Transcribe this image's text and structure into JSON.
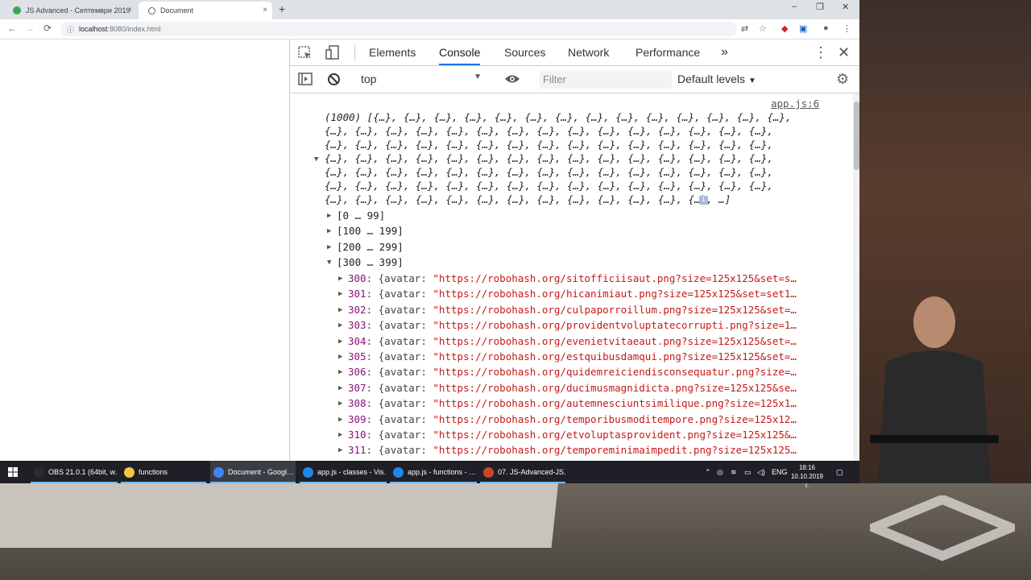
{
  "browser": {
    "tabs": [
      {
        "title": "JS Advanced - Септември 2019",
        "close": "×"
      },
      {
        "title": "Document",
        "close": "×"
      }
    ],
    "new_tab": "+",
    "window_controls": {
      "minimize": "–",
      "maximize": "❐",
      "close": "✕"
    },
    "nav": {
      "back": "←",
      "forward": "→",
      "reload": "⟳"
    },
    "address": {
      "host": "localhost",
      "port_path": ":8080/index.html"
    }
  },
  "devtools": {
    "tabs": [
      "Elements",
      "Console",
      "Sources",
      "Network",
      "Performance"
    ],
    "active_tab": "Console",
    "more_tabs": "»",
    "context": "top",
    "filter_placeholder": "Filter",
    "levels": "Default levels",
    "source_link": "app.js:6",
    "array_lines": [
      "(1000) [{…}, {…}, {…}, {…}, {…}, {…}, {…}, {…}, {…}, {…}, {…}, {…}, {…}, {…},",
      "{…}, {…}, {…}, {…}, {…}, {…}, {…}, {…}, {…}, {…}, {…}, {…}, {…}, {…}, {…},",
      "{…}, {…}, {…}, {…}, {…}, {…}, {…}, {…}, {…}, {…}, {…}, {…}, {…}, {…}, {…},",
      "{…}, {…}, {…}, {…}, {…}, {…}, {…}, {…}, {…}, {…}, {…}, {…}, {…}, {…}, {…},",
      "{…}, {…}, {…}, {…}, {…}, {…}, {…}, {…}, {…}, {…}, {…}, {…}, {…}, {…}, {…},",
      "{…}, {…}, {…}, {…}, {…}, {…}, {…}, {…}, {…}, {…}, {…}, {…}, {…}, {…}, {…},",
      "{…}, {…}, {…}, {…}, {…}, {…}, {…}, {…}, {…}, {…}, {…}, {…}, {…}, …]"
    ],
    "info_badge": "i",
    "ranges": [
      "[0 … 99]",
      "[100 … 199]",
      "[200 … 299]",
      "[300 … 399]"
    ],
    "rows": [
      {
        "index": "300:",
        "key": "{avatar:",
        "value": "\"https://robohash.org/sitofficiisaut.png?size=125x125&set=s…"
      },
      {
        "index": "301:",
        "key": "{avatar:",
        "value": "\"https://robohash.org/hicanimiaut.png?size=125x125&set=set1…"
      },
      {
        "index": "302:",
        "key": "{avatar:",
        "value": "\"https://robohash.org/culpaporroillum.png?size=125x125&set=…"
      },
      {
        "index": "303:",
        "key": "{avatar:",
        "value": "\"https://robohash.org/providentvoluptatecorrupti.png?size=1…"
      },
      {
        "index": "304:",
        "key": "{avatar:",
        "value": "\"https://robohash.org/evenietvitaeaut.png?size=125x125&set=…"
      },
      {
        "index": "305:",
        "key": "{avatar:",
        "value": "\"https://robohash.org/estquibusdamqui.png?size=125x125&set=…"
      },
      {
        "index": "306:",
        "key": "{avatar:",
        "value": "\"https://robohash.org/quidemreiciendisconsequatur.png?size=…"
      },
      {
        "index": "307:",
        "key": "{avatar:",
        "value": "\"https://robohash.org/ducimusmagnidicta.png?size=125x125&se…"
      },
      {
        "index": "308:",
        "key": "{avatar:",
        "value": "\"https://robohash.org/autemnesciuntsimilique.png?size=125x1…"
      },
      {
        "index": "309:",
        "key": "{avatar:",
        "value": "\"https://robohash.org/temporibusmoditempore.png?size=125x12…"
      },
      {
        "index": "310:",
        "key": "{avatar:",
        "value": "\"https://robohash.org/etvoluptasprovident.png?size=125x125&…"
      },
      {
        "index": "311:",
        "key": "{avatar:",
        "value": "\"https://robohash.org/temporeminimaimpedit.png?size=125x125…"
      }
    ]
  },
  "taskbar": {
    "items": [
      {
        "label": "OBS 21.0.1 (64bit, w…",
        "color": "#2b2b2b"
      },
      {
        "label": "functions",
        "color": "#f2c744"
      },
      {
        "label": "Document - Googl…",
        "color": "#4285f4"
      },
      {
        "label": "app.js - classes - Vis…",
        "color": "#1e88e5"
      },
      {
        "label": "app.js - functions - …",
        "color": "#1e88e5"
      },
      {
        "label": "07. JS-Advanced-JS…",
        "color": "#d04423"
      }
    ],
    "tray_caret": "⌃",
    "language": "ENG",
    "time": "18:16",
    "date": "10.10.2019 г."
  }
}
